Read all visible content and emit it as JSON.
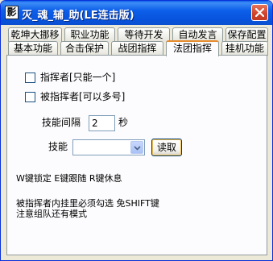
{
  "window": {
    "title": "灭_魂_辅_助(LE连击版)",
    "app_icon_glyph": "影"
  },
  "tabs_row1": [
    {
      "label": "乾坤大挪移"
    },
    {
      "label": "职业功能"
    },
    {
      "label": "等待开发"
    },
    {
      "label": "自动发言"
    },
    {
      "label": "保存配置"
    }
  ],
  "tabs_row2": [
    {
      "label": "基本功能"
    },
    {
      "label": "合击保护"
    },
    {
      "label": "战团指挥"
    },
    {
      "label": "法团指挥",
      "active": true
    },
    {
      "label": "挂机功能"
    }
  ],
  "panel": {
    "commander_checkbox": {
      "label": "指挥者[只能一个]",
      "checked": false
    },
    "commanded_checkbox": {
      "label": "被指挥者[可以多号]",
      "checked": false
    },
    "skill_interval": {
      "label": "技能间隔",
      "value": "2",
      "unit": "秒"
    },
    "skill": {
      "label": "技能",
      "value": ""
    },
    "read_button": "读取",
    "hotkeys_line": "W键锁定 E键跟随 R键休息",
    "note_line1": "被指挥者内挂里必须勾选 免SHIFT键",
    "note_line2": "注意组队还有模式"
  },
  "colors": {
    "titlebar": "#0a5ee8",
    "active_tab_accent": "#e68b2c",
    "dialog_bg": "#ece9d8",
    "panel_bg": "#fcfcfe"
  },
  "icons": {
    "close": "close-icon",
    "app": "app-icon",
    "dropdown": "chevron-down-icon"
  }
}
